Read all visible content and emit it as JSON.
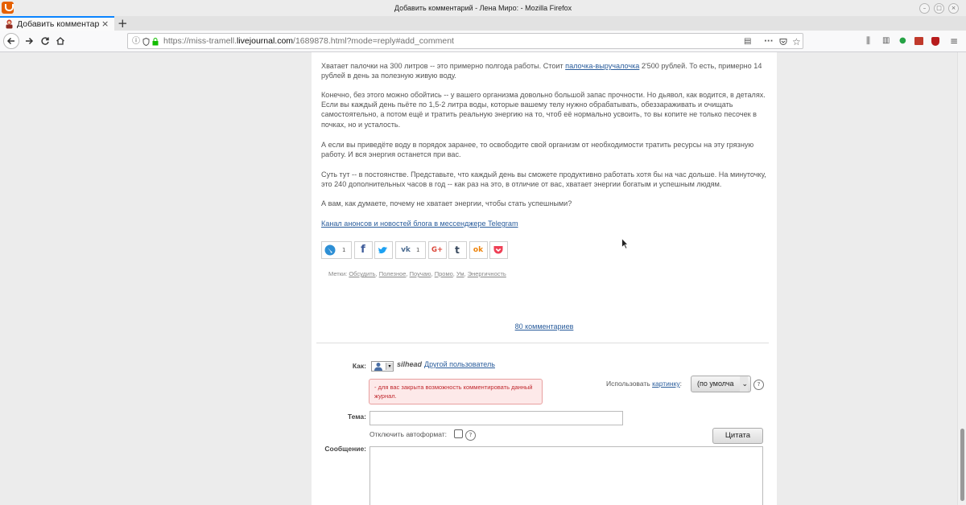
{
  "window": {
    "title": "Добавить комментарий - Лена Миро: - Mozilla Firefox"
  },
  "tab": {
    "label": "Добавить комментари",
    "close_glyph": "×",
    "new_tab_glyph": "+"
  },
  "url": {
    "prefix": "https://miss-tramell.",
    "domain": "livejournal.com",
    "suffix": "/1689878.html?mode=reply#add_comment"
  },
  "article": {
    "p1_a": "Хватает палочки на 300 литров -- это примерно полгода работы. Стоит ",
    "p1_link": "палочка-выручалочка",
    "p1_b": " 2'500 рублей. То есть, примерно 14 рублей в день за полезную живую воду.",
    "p2": "Конечно, без этого можно обойтись -- у вашего организма довольно большой запас прочности. Но дьявол, как водится, в деталях. Если вы каждый день пьёте по 1,5-2 литра воды, которые вашему телу нужно обрабатывать, обеззараживать и очищать самостоятельно, а потом ещё и тратить реальную энергию на то, чтоб её нормально усвоить, то вы копите не только песочек в почках, но и усталость.",
    "p3": "А если вы приведёте воду в порядок заранее, то освободите свой организм от необходимости тратить ресурсы на эту грязную работу. И вся энергия останется при вас.",
    "p4": "Суть тут -- в постоянстве. Представьте, что каждый день вы сможете продуктивно работать хотя бы на час дольше. На минуточку, это 240 дополнительных часов в год -- как раз на это, в отличие от вас, хватает энергии богатым и успешным людям.",
    "p5": "А вам, как думаете, почему не хватает энергии, чтобы стать успешными?",
    "telegram_link": "Канал анонсов и новостей блога в мессенджере Telegram"
  },
  "share": {
    "lj_count": "1",
    "vk_count": "1",
    "facebook_glyph": "f",
    "vk_glyph": "vk",
    "google_glyph": "G+",
    "tumblr_glyph": "t",
    "ok_glyph": "ok"
  },
  "tags": {
    "label": "Метки:",
    "items": [
      "Обсудить",
      "Полезное",
      "Поучаю",
      "Промо",
      "Ум",
      "Энергичность"
    ]
  },
  "comments_link": "80 комментариев",
  "form": {
    "as_label": "Как:",
    "username": "silhead",
    "other_user": "Другой пользователь",
    "error": "- для вас закрыта возможность комментировать данный журнал.",
    "use_picture_a": "Использовать",
    "use_picture_link": "картинку",
    "use_picture_b": ":",
    "picture_select": "(по умолча",
    "subject_label": "Тема:",
    "subject_value": "",
    "autoformat_label": "Отключить автоформат:",
    "help_glyph": "?",
    "quote_button": "Цитата",
    "message_label": "Сообщение:",
    "message_value": ""
  },
  "colors": {
    "link": "#2a5d9c",
    "error_text": "#c0282e",
    "error_bg": "#fde9e9",
    "firefox_orange": "#e66000"
  }
}
